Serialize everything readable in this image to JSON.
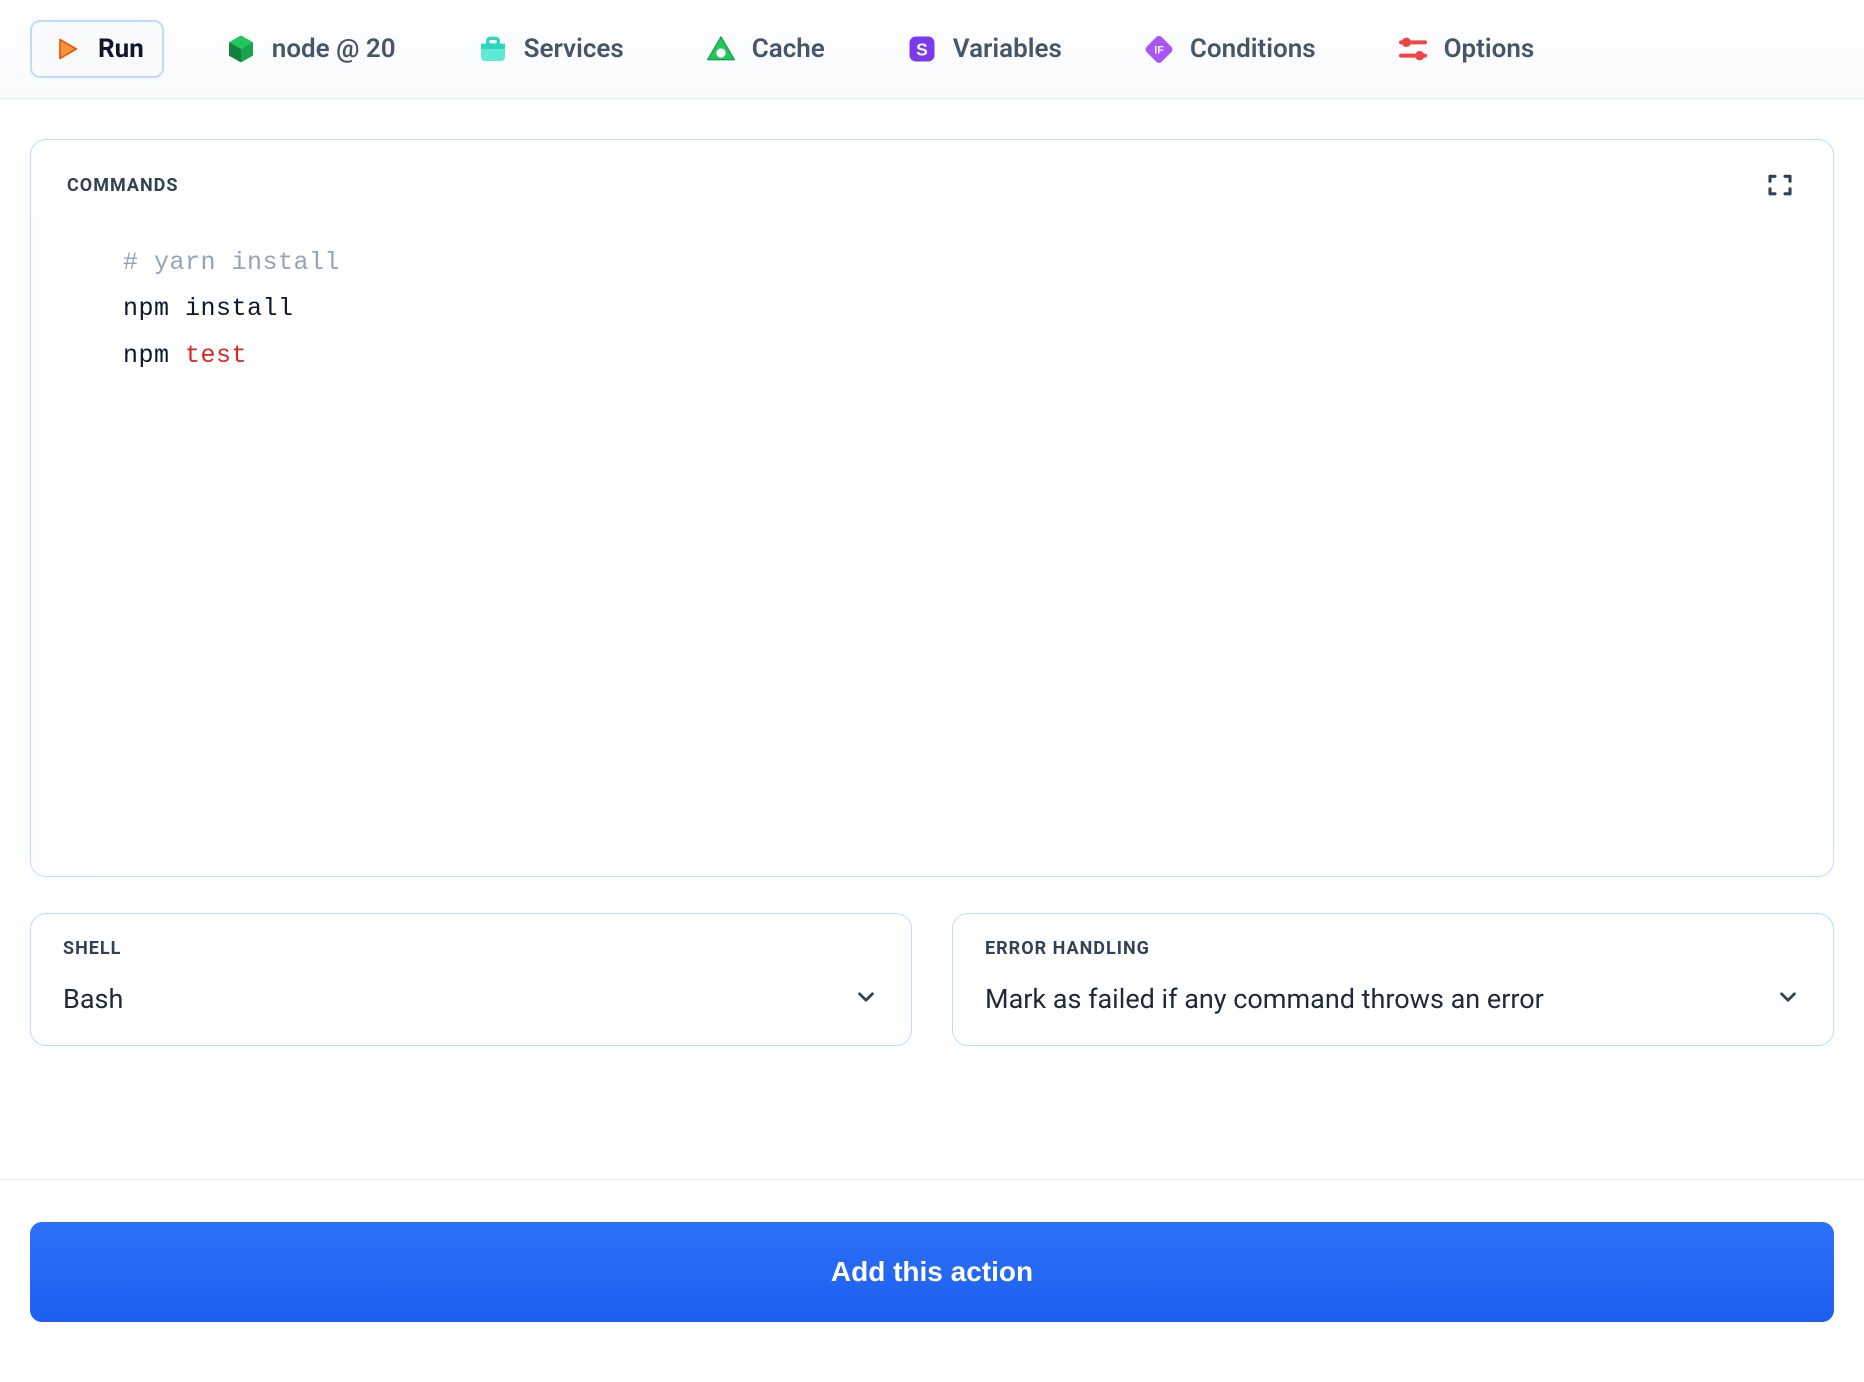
{
  "tabs": {
    "run": {
      "label": "Run"
    },
    "environment": {
      "label": "node @ 20"
    },
    "services": {
      "label": "Services"
    },
    "cache": {
      "label": "Cache"
    },
    "variables": {
      "label": "Variables"
    },
    "conditions": {
      "label": "Conditions"
    },
    "options": {
      "label": "Options"
    }
  },
  "commands": {
    "label": "COMMANDS",
    "lines": [
      {
        "text": "# yarn install",
        "type": "comment"
      },
      {
        "text": "npm install",
        "type": "plain"
      },
      {
        "text": "npm ",
        "type": "plain",
        "suffix": "test",
        "suffix_type": "keyword"
      }
    ]
  },
  "shell": {
    "label": "SHELL",
    "value": "Bash"
  },
  "error_handling": {
    "label": "ERROR HANDLING",
    "value": "Mark as failed if any command throws an error"
  },
  "footer": {
    "add_label": "Add this action"
  },
  "icons": {
    "run": "play-icon",
    "environment": "node-icon",
    "services": "package-icon",
    "cache": "triangle-icon",
    "variables": "dollar-icon",
    "conditions": "if-icon",
    "options": "sliders-icon",
    "expand": "expand-icon",
    "chevron": "chevron-down-icon"
  },
  "colors": {
    "accent_blue": "#1d5ef0",
    "tab_border": "#bfdbfe",
    "run_orange": "#f97316",
    "node_green": "#16a34a",
    "services_teal": "#5eead4",
    "cache_green": "#22c55e",
    "variables_purple": "#7c3aed",
    "conditions_purple": "#a855f7",
    "options_red": "#ef4444"
  }
}
